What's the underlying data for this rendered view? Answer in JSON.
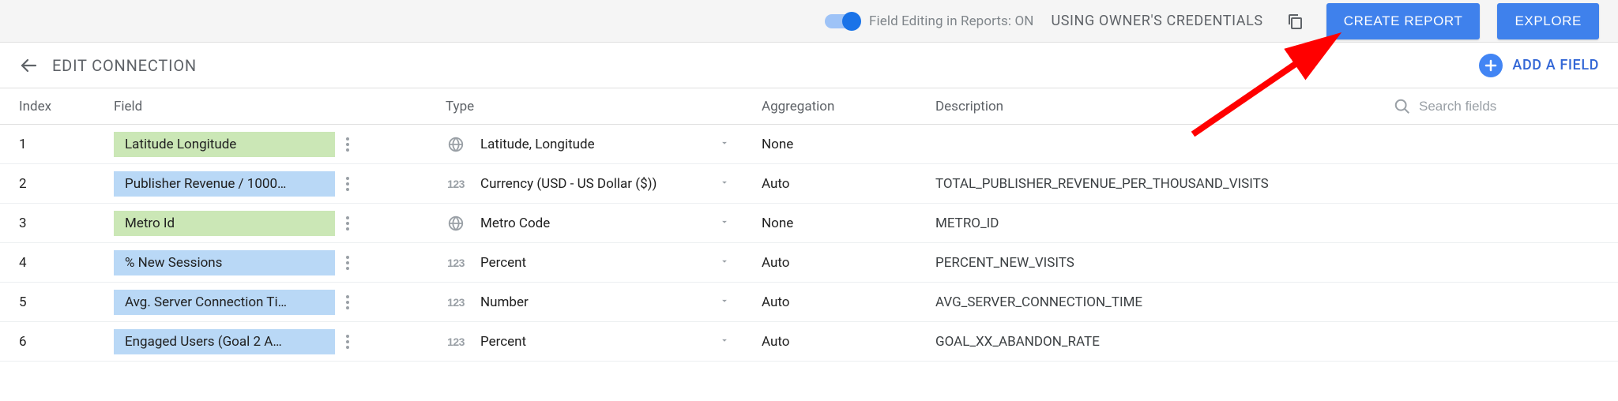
{
  "topbar": {
    "toggle_label": "Field Editing in Reports: ON",
    "credentials": "USING OWNER'S CREDENTIALS",
    "create_report": "CREATE REPORT",
    "explore": "EXPLORE"
  },
  "editbar": {
    "title": "EDIT CONNECTION",
    "add_field": "ADD A FIELD"
  },
  "headers": {
    "index": "Index",
    "field": "Field",
    "type": "Type",
    "aggregation": "Aggregation",
    "description": "Description",
    "search_placeholder": "Search fields"
  },
  "rows": [
    {
      "index": "1",
      "field": "Latitude Longitude",
      "chip": "green",
      "type_icon": "globe",
      "type": "Latitude, Longitude",
      "agg": "None",
      "desc": ""
    },
    {
      "index": "2",
      "field": "Publisher Revenue / 1000…",
      "chip": "blue",
      "type_icon": "123",
      "type": "Currency (USD - US Dollar ($))",
      "agg": "Auto",
      "desc": "TOTAL_PUBLISHER_REVENUE_PER_THOUSAND_VISITS"
    },
    {
      "index": "3",
      "field": "Metro Id",
      "chip": "green",
      "type_icon": "globe",
      "type": "Metro Code",
      "agg": "None",
      "desc": "METRO_ID"
    },
    {
      "index": "4",
      "field": "% New Sessions",
      "chip": "blue",
      "type_icon": "123",
      "type": "Percent",
      "agg": "Auto",
      "desc": "PERCENT_NEW_VISITS"
    },
    {
      "index": "5",
      "field": "Avg. Server Connection Ti…",
      "chip": "blue",
      "type_icon": "123",
      "type": "Number",
      "agg": "Auto",
      "desc": "AVG_SERVER_CONNECTION_TIME"
    },
    {
      "index": "6",
      "field": "Engaged Users (Goal 2 A…",
      "chip": "blue",
      "type_icon": "123",
      "type": "Percent",
      "agg": "Auto",
      "desc": "GOAL_XX_ABANDON_RATE"
    }
  ]
}
